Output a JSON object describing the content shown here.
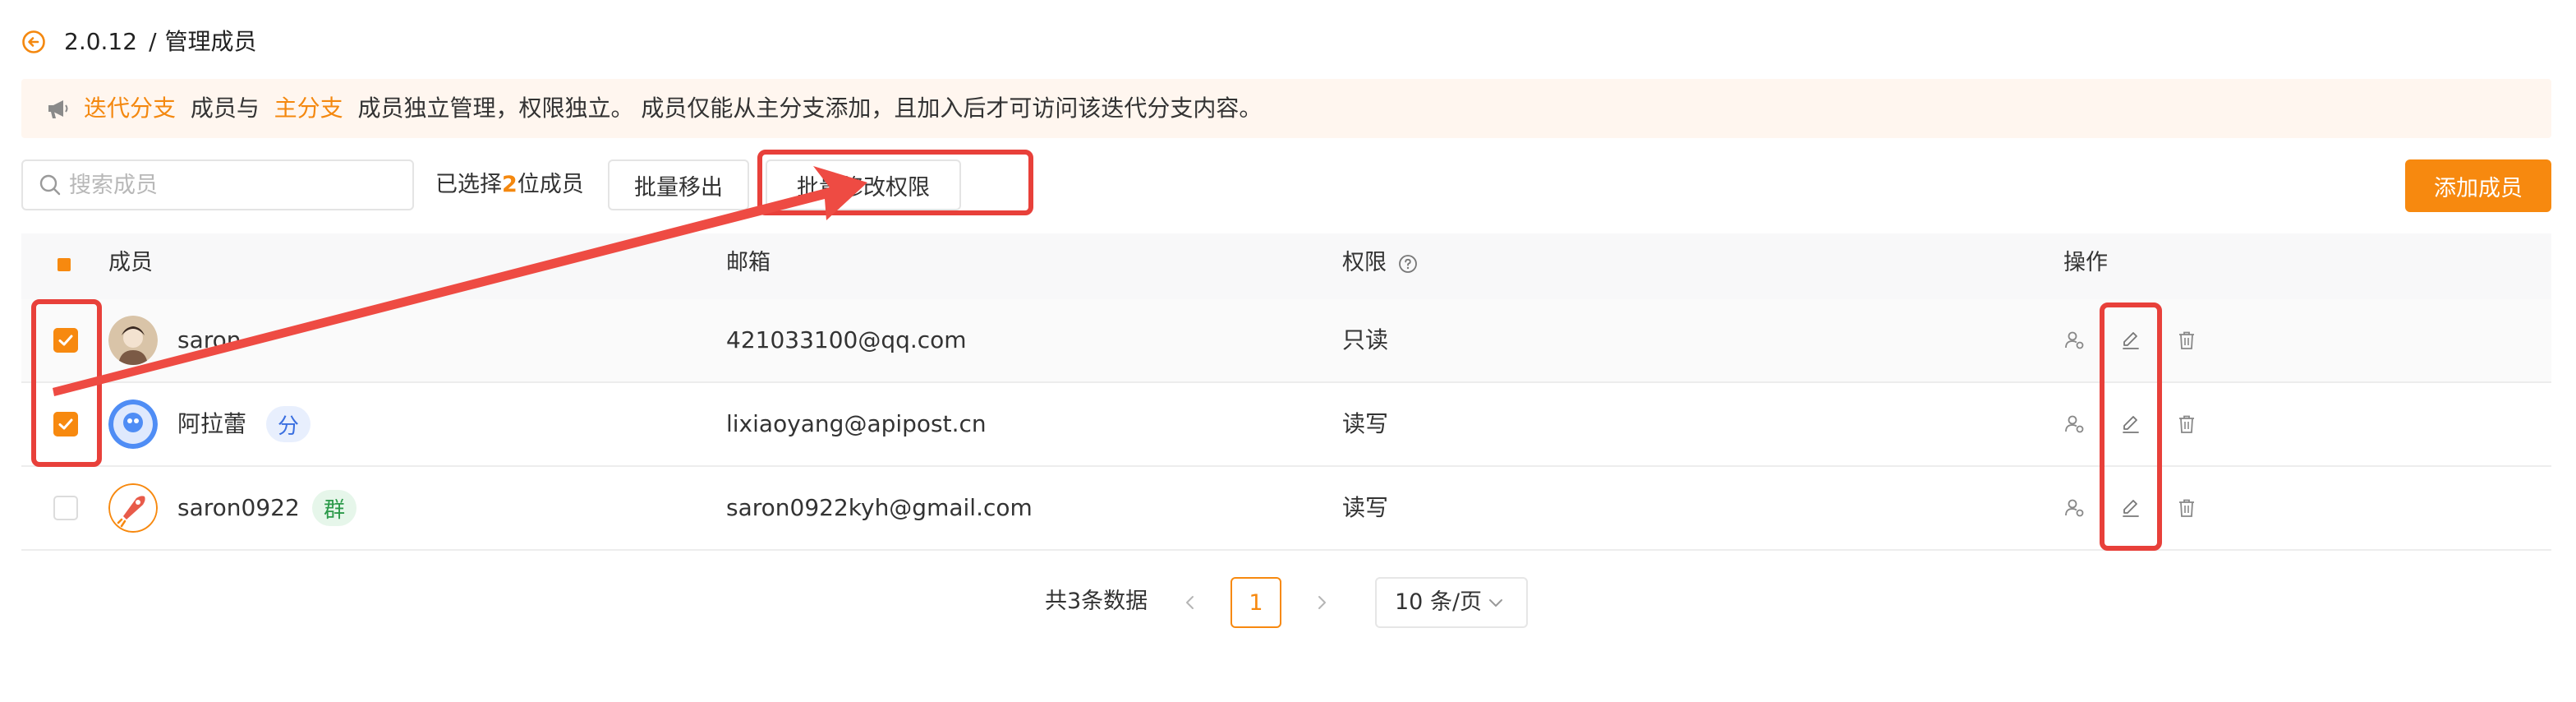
{
  "header": {
    "version": "2.0.12",
    "separator": "/",
    "title": "管理成员"
  },
  "notice": {
    "part1": "迭代分支",
    "part2": "成员与",
    "part3": "主分支",
    "part4": "成员独立管理，权限独立。 成员仅能从主分支添加，且加入后才可访问该迭代分支内容。"
  },
  "toolbar": {
    "search_placeholder": "搜索成员",
    "search_value": "",
    "selected_prefix": "已选择",
    "selected_count": "2",
    "selected_suffix": "位成员",
    "batch_remove": "批量移出",
    "batch_edit": "批量修改权限",
    "add_member": "添加成员"
  },
  "table": {
    "headers": {
      "member": "成员",
      "email": "邮箱",
      "permission": "权限",
      "actions": "操作"
    },
    "rows": [
      {
        "name": "saron",
        "tag": "",
        "email": "421033100@qq.com",
        "permission": "只读",
        "checked": true
      },
      {
        "name": "阿拉蕾",
        "tag": "分",
        "email": "lixiaoyang@apipost.cn",
        "permission": "读写",
        "checked": true
      },
      {
        "name": "saron0922",
        "tag": "群",
        "email": "saron0922kyh@gmail.com",
        "permission": "读写",
        "checked": false
      }
    ]
  },
  "pagination": {
    "total_text": "共3条数据",
    "current_page": "1",
    "page_size": "10 条/页"
  },
  "colors": {
    "accent": "#f7890f",
    "annotation": "#e8403a",
    "notice_bg": "#fff6ef"
  }
}
